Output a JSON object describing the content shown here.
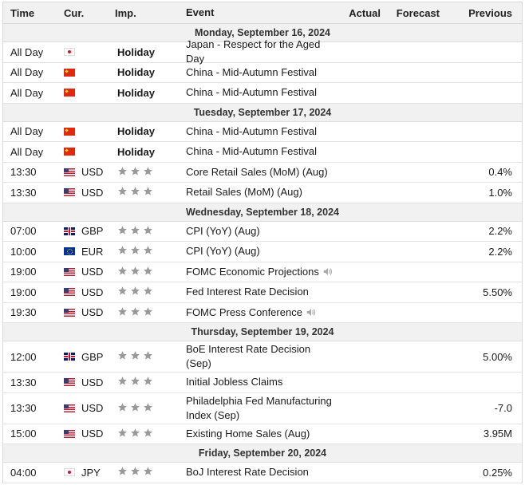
{
  "headers": {
    "time": "Time",
    "cur": "Cur.",
    "imp": "Imp.",
    "event": "Event",
    "actual": "Actual",
    "forecast": "Forecast",
    "previous": "Previous"
  },
  "sections": [
    {
      "date": "Monday, September 16, 2024",
      "rows": [
        {
          "time": "All Day",
          "flag": "japan-flag",
          "cur": "",
          "holiday": "Holiday",
          "event": "Japan - Respect for the Aged Day",
          "actual": "",
          "forecast": "",
          "previous": ""
        },
        {
          "time": "All Day",
          "flag": "china-flag",
          "cur": "",
          "holiday": "Holiday",
          "event": "China - Mid-Autumn Festival",
          "actual": "",
          "forecast": "",
          "previous": ""
        },
        {
          "time": "All Day",
          "flag": "china-flag",
          "cur": "",
          "holiday": "Holiday",
          "event": "China - Mid-Autumn Festival",
          "actual": "",
          "forecast": "",
          "previous": ""
        }
      ]
    },
    {
      "date": "Tuesday, September 17, 2024",
      "rows": [
        {
          "time": "All Day",
          "flag": "china-flag",
          "cur": "",
          "holiday": "Holiday",
          "event": "China - Mid-Autumn Festival",
          "actual": "",
          "forecast": "",
          "previous": ""
        },
        {
          "time": "All Day",
          "flag": "china-flag",
          "cur": "",
          "holiday": "Holiday",
          "event": "China - Mid-Autumn Festival",
          "actual": "",
          "forecast": "",
          "previous": ""
        },
        {
          "time": "13:30",
          "flag": "us-flag",
          "cur": "USD",
          "stars": 3,
          "event": "Core Retail Sales (MoM) (Aug)",
          "actual": "",
          "forecast": "",
          "previous": "0.4%"
        },
        {
          "time": "13:30",
          "flag": "us-flag",
          "cur": "USD",
          "stars": 3,
          "event": "Retail Sales (MoM) (Aug)",
          "actual": "",
          "forecast": "",
          "previous": "1.0%"
        }
      ]
    },
    {
      "date": "Wednesday, September 18, 2024",
      "rows": [
        {
          "time": "07:00",
          "flag": "uk-flag",
          "cur": "GBP",
          "stars": 3,
          "event": "CPI (YoY) (Aug)",
          "actual": "",
          "forecast": "",
          "previous": "2.2%"
        },
        {
          "time": "10:00",
          "flag": "eu-flag",
          "cur": "EUR",
          "stars": 3,
          "event": "CPI (YoY) (Aug)",
          "actual": "",
          "forecast": "",
          "previous": "2.2%"
        },
        {
          "time": "19:00",
          "flag": "us-flag",
          "cur": "USD",
          "stars": 3,
          "event": "FOMC Economic Projections",
          "speaker": true,
          "actual": "",
          "forecast": "",
          "previous": ""
        },
        {
          "time": "19:00",
          "flag": "us-flag",
          "cur": "USD",
          "stars": 3,
          "event": "Fed Interest Rate Decision",
          "actual": "",
          "forecast": "",
          "previous": "5.50%"
        },
        {
          "time": "19:30",
          "flag": "us-flag",
          "cur": "USD",
          "stars": 3,
          "event": "FOMC Press Conference",
          "speaker": true,
          "actual": "",
          "forecast": "",
          "previous": ""
        }
      ]
    },
    {
      "date": "Thursday, September 19, 2024",
      "rows": [
        {
          "time": "12:00",
          "flag": "uk-flag",
          "cur": "GBP",
          "stars": 3,
          "event": "BoE Interest Rate Decision (Sep)",
          "tall": true,
          "actual": "",
          "forecast": "",
          "previous": "5.00%"
        },
        {
          "time": "13:30",
          "flag": "us-flag",
          "cur": "USD",
          "stars": 3,
          "event": "Initial Jobless Claims",
          "actual": "",
          "forecast": "",
          "previous": ""
        },
        {
          "time": "13:30",
          "flag": "us-flag",
          "cur": "USD",
          "stars": 3,
          "event": "Philadelphia Fed Manufacturing Index (Sep)",
          "tall": true,
          "actual": "",
          "forecast": "",
          "previous": "-7.0"
        },
        {
          "time": "15:00",
          "flag": "us-flag",
          "cur": "USD",
          "stars": 3,
          "event": "Existing Home Sales (Aug)",
          "actual": "",
          "forecast": "",
          "previous": "3.95M"
        }
      ]
    },
    {
      "date": "Friday, September 20, 2024",
      "rows": [
        {
          "time": "04:00",
          "flag": "japan-flag",
          "cur": "JPY",
          "stars": 3,
          "event": "BoJ Interest Rate Decision",
          "actual": "",
          "forecast": "",
          "previous": "0.25%"
        }
      ]
    }
  ]
}
